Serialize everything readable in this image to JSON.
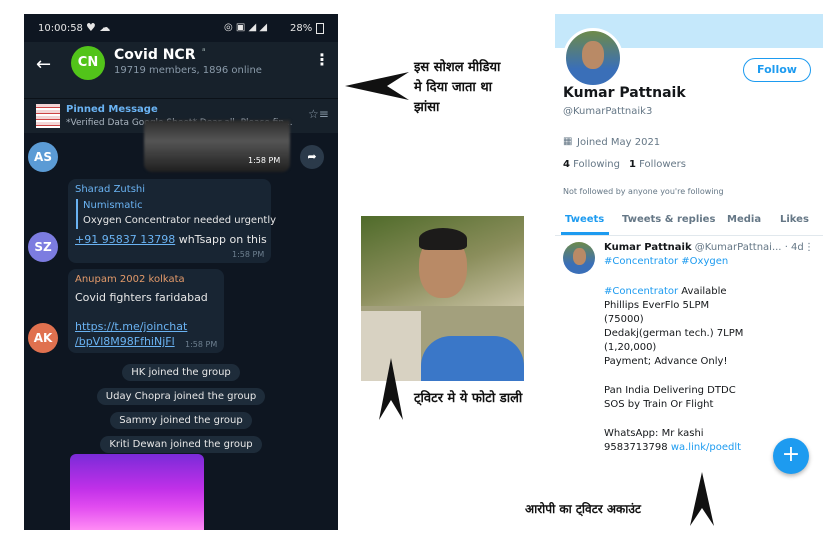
{
  "telegram": {
    "status_time": "10:00:58",
    "battery": "28%",
    "group_name": "Covid NCR",
    "group_initials": "CN",
    "members": "19719 members, 1896 online",
    "pinned_title": "Pinned Message",
    "pinned_text": "*Verified Data Google Sheet* Dear all,  Please fin...",
    "msg1": {
      "initials": "AS",
      "time": "1:58 PM"
    },
    "msg2": {
      "initials": "SZ",
      "sender": "Sharad Zutshi",
      "reply_author": "Numismatic",
      "reply_text": "Oxygen Concentrator needed urgently",
      "phone": "+91 95837 13798",
      "suffix": " whTsapp on this",
      "time": "1:58 PM"
    },
    "msg3": {
      "initials": "AK",
      "sender": "Anupam 2002 kolkata",
      "text": "Covid fighters faridabad",
      "link1": "https://t.me/joinchat",
      "link2": "/bpVl8M98FfhiNjFl",
      "time": "1:58 PM"
    },
    "system_messages": [
      "HK joined the group",
      "Uday Chopra joined the group",
      "Sammy joined the group",
      "Kriti Dewan joined the group"
    ],
    "colors": {
      "bg": "#0e1621",
      "header": "#17212b",
      "accent": "#6ab3f3"
    }
  },
  "annotations": {
    "telegram_caption": [
      "इस  सोशल मीडिया",
      "मे दिया जाता था",
      "झांसा"
    ],
    "photo_caption": "ट्विटर मे ये फोटो डाली",
    "account_caption": "आरोपी का ट्विटर अकाउंट"
  },
  "twitter": {
    "follow_label": "Follow",
    "name": "Kumar Pattnaik",
    "handle": "@KumarPattnaik3",
    "joined": "Joined May 2021",
    "following_count": "4",
    "following_label": " Following",
    "followers_count": "1",
    "followers_label": " Followers",
    "not_followed": "Not followed by anyone you're following",
    "tabs": [
      "Tweets",
      "Tweets & replies",
      "Media",
      "Likes"
    ],
    "tweet": {
      "name": "Kumar Pattnaik",
      "handle": "@KumarPattnai...",
      "age": "· 4d",
      "hashtags": "#Concentrator #Oxygen",
      "hashtag2": "#Concentrator",
      "line1": " Available",
      "lines": [
        "Phillips EverFlo 5LPM",
        "(75000)",
        "Dedakj(german tech.) 7LPM",
        "(1,20,000)",
        "Payment; Advance Only!"
      ],
      "lines2": [
        "Pan India Delivering DTDC",
        "SOS by Train Or Flight"
      ],
      "whatsapp": "WhatsApp: Mr kashi",
      "phone": " 9583713798 ",
      "link": "wa.link/poedlt"
    },
    "fab_label": "+",
    "colors": {
      "accent": "#1d9bf0",
      "banner": "#c5e8fb"
    }
  }
}
